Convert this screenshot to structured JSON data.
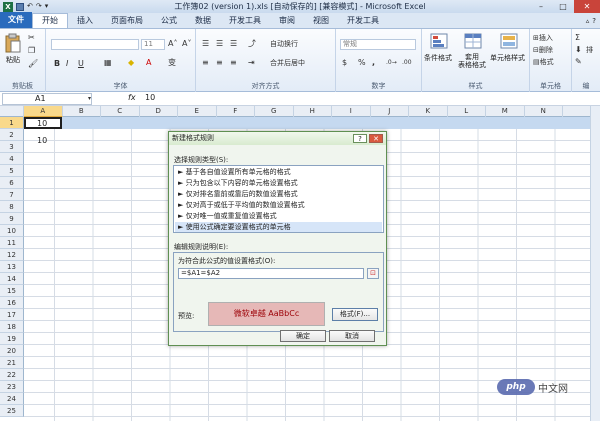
{
  "window": {
    "title": "工作簿02 (version 1).xls [自动保存的] [兼容模式] - Microsoft Excel",
    "buttons": {
      "minimize": "–",
      "maximize": "□",
      "close": "✕"
    }
  },
  "ribbon_tabs": [
    "文件",
    "开始",
    "插入",
    "页面布局",
    "公式",
    "数据",
    "开发工具",
    "审阅",
    "视图",
    "开发工具"
  ],
  "ribbon": {
    "clipboard": {
      "label": "剪贴板",
      "paste": "粘贴"
    },
    "font": {
      "label": "字体",
      "size": "11",
      "bold": "B",
      "italic": "I",
      "underline": "U",
      "wen": "变"
    },
    "alignment": {
      "label": "对齐方式",
      "wrap": "自动换行",
      "merge": "合并后居中"
    },
    "number": {
      "label": "数字",
      "format": "常规",
      "percent": "%",
      "comma": ","
    },
    "styles": {
      "label": "样式",
      "conditional": "条件格式",
      "table": "套用\n表格格式",
      "cell": "单元格样式"
    },
    "cells": {
      "label": "单元格",
      "insert": "插入",
      "delete": "删除",
      "format": "格式"
    },
    "editing": {
      "label": "编",
      "sum": "Σ",
      "sort": "排"
    }
  },
  "formula_bar": {
    "name_box": "A1",
    "fx": "fx",
    "value": "10"
  },
  "grid": {
    "columns": [
      "A",
      "B",
      "C",
      "D",
      "E",
      "F",
      "G",
      "H",
      "I",
      "J",
      "K",
      "L",
      "M",
      "N"
    ],
    "rows": [
      "1",
      "2",
      "3",
      "4",
      "5",
      "6",
      "7",
      "8",
      "9",
      "10",
      "11",
      "12",
      "13",
      "14",
      "15",
      "16",
      "17",
      "18",
      "19",
      "20",
      "21",
      "22",
      "23",
      "24",
      "25"
    ],
    "A1": "10",
    "A2": "10"
  },
  "dialog": {
    "title": "新建格式规则",
    "help": "?",
    "close": "✕",
    "rule_type_label": "选择规则类型(S):",
    "rule_types": [
      "► 基于各自值设置所有单元格的格式",
      "► 只为包含以下内容的单元格设置格式",
      "► 仅对排名靠前或靠后的数值设置格式",
      "► 仅对高于或低于平均值的数值设置格式",
      "► 仅对唯一值或重复值设置格式",
      "► 使用公式确定要设置格式的单元格"
    ],
    "selected_rule_index": 5,
    "desc_label": "编辑规则说明(E):",
    "formula_label": "为符合此公式的值设置格式(O):",
    "formula_value": "=$A1=$A2",
    "preview_label": "预览:",
    "preview_text": "微软卓越  AaBbCc",
    "format_button": "格式(F)...",
    "ok": "确定",
    "cancel": "取消"
  },
  "watermark": {
    "logo": "php",
    "text": "中文网"
  },
  "colors": {
    "file_tab": "#2a6bbd",
    "preview_fill": "#e6b8b7",
    "preview_text": "#9c0006",
    "row_highlight": "#c5d9f0",
    "header_selected": "#f9d98b"
  }
}
